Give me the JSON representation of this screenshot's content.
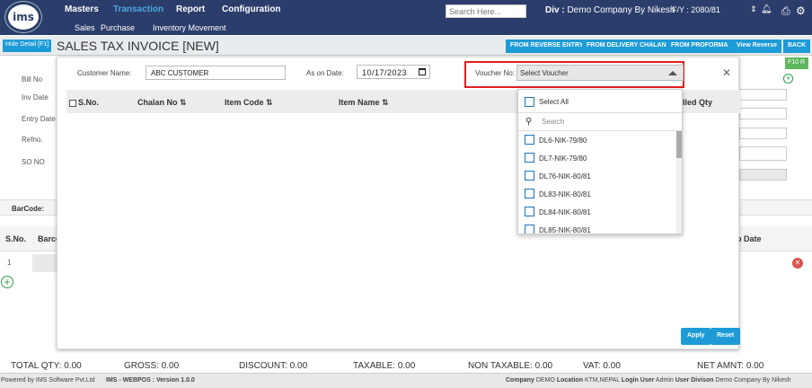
{
  "nav": {
    "logo": "ims",
    "items": [
      "Masters",
      "Transaction",
      "Report",
      "Configuration"
    ],
    "search_placeholder": "Search Here...",
    "div_label": "Div :",
    "div_value": "Demo Company By Nikesh",
    "fy": "F/Y : 2080/81",
    "sub_items": [
      "Sales",
      "Purchase",
      "Inventory Movement"
    ]
  },
  "toolbar": {
    "hide_detail": "Hide Detail [F1]",
    "title": "SALES TAX INVOICE [NEW]",
    "buttons": [
      "FROM REVERSE ENTRY",
      "FROM DELIVERY CHALAN",
      "FROM PROFORMA",
      "View Reverse",
      "BACK"
    ]
  },
  "form": {
    "labels": [
      "Bill No",
      "Inv Date",
      "Entry Date",
      "Refno.",
      "SO NO"
    ],
    "f10": "F10 R"
  },
  "barcode_label": "BarCode:",
  "grid": {
    "headers": [
      "S.No.",
      "Barco",
      "p Date"
    ],
    "row1_sno": "1"
  },
  "modal": {
    "customer_label": "Customer Name:",
    "customer_value": "ABC CUSTOMER",
    "as_on_label": "As on Date:",
    "date_value": "10/17/2023",
    "voucher_label": "Voucher No:",
    "voucher_value": "Select Voucher",
    "grid_headers": [
      "S.No.",
      "Chalan No ⇅",
      "Item Code ⇅",
      "Item Name ⇅",
      "lled Qty"
    ],
    "apply": "Apply",
    "reset": "Reset"
  },
  "dropdown": {
    "select_all": "Select All",
    "search_placeholder": "Search",
    "items": [
      "DL6-NIK-79/80",
      "DL7-NIK-79/80",
      "DL76-NIK-80/81",
      "DL83-NIK-80/81",
      "DL84-NIK-80/81",
      "DL85-NIK-80/81"
    ]
  },
  "totals": {
    "total_qty": "TOTAL QTY: 0.00",
    "gross": "GROSS: 0.00",
    "discount": "DISCOUNT: 0.00",
    "taxable": "TAXABLE: 0.00",
    "non_taxable": "NON TAXABLE: 0.00",
    "vat": "VAT: 0.00",
    "net_amnt": "NET AMNT: 0.00"
  },
  "footer": {
    "powered": "Powered by IMS Software Pvt.Ltd",
    "version": "IMS - WEBPOS : Version 1.0.0",
    "company_label": "Company",
    "company_value": "DEMO",
    "location_label": "Location",
    "location_value": "KTM,NEPAL",
    "login_label": "Login User",
    "login_value": "Admin",
    "division_label": "User Divison",
    "division_value": "Demo Company By Nikesh"
  },
  "colors": {
    "nav_bg": "#2b3d6b",
    "accent": "#1e9bd7",
    "highlight_border": "#e02020",
    "active_nav": "#4aa8e0"
  }
}
